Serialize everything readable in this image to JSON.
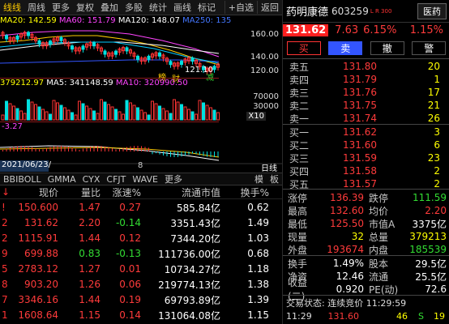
{
  "toolbar": {
    "items": [
      "线线",
      "周线",
      "更多",
      "复权",
      "叠加",
      "多股",
      "统计",
      "画线",
      "标记",
      "+自选",
      "返回"
    ]
  },
  "ma": {
    "ma20": "MA20: 142.59",
    "ma60": "MA60: 151.79",
    "ma120": "MA120: 148.07",
    "ma250": "MA250: 135"
  },
  "price_axis": [
    "160.00",
    "140.00",
    "120.00"
  ],
  "price_low_label": "121.10",
  "event_tags": [
    "榜",
    "财",
    "减"
  ],
  "vol": {
    "vol": "379212.97",
    "ma5": "MA5: 341148.59",
    "ma10": "MA10: 320990.50"
  },
  "vol_axis": [
    "70000",
    "30000"
  ],
  "vol_unit": "X10",
  "macd": "-3.27",
  "date_label": "2021/06/23/三",
  "mid_mark": "8",
  "period": "日线",
  "bottom_tabs": [
    "BBIBOLL",
    "GMMA",
    "CYX",
    "CFJT",
    "WAVE",
    "更多",
    "模",
    "板"
  ],
  "table": {
    "headers": [
      "现价",
      "量比",
      "涨速%",
      "流通市值",
      "换手%"
    ],
    "rows": [
      {
        "mark": "!",
        "price": "150.600",
        "vr": "1.47",
        "spd": "0.27",
        "cap": "585.84亿",
        "tr": "0.62",
        "price_c": "red",
        "vr_c": "red",
        "spd_c": "red"
      },
      {
        "mark": "2",
        "price": "131.62",
        "vr": "2.20",
        "spd": "-0.14",
        "cap": "3351.43亿",
        "tr": "1.49",
        "price_c": "red",
        "vr_c": "red",
        "spd_c": "grn"
      },
      {
        "mark": "2",
        "price": "1115.91",
        "vr": "1.44",
        "spd": "0.12",
        "cap": "7344.20亿",
        "tr": "1.03",
        "price_c": "red",
        "vr_c": "red",
        "spd_c": "red"
      },
      {
        "mark": "9",
        "price": "699.88",
        "vr": "0.83",
        "spd": "-0.13",
        "cap": "111736.00亿",
        "tr": "0.68",
        "price_c": "red",
        "vr_c": "grn",
        "spd_c": "grn"
      },
      {
        "mark": "5",
        "price": "2783.12",
        "vr": "1.27",
        "spd": "0.01",
        "cap": "10734.27亿",
        "tr": "1.18",
        "price_c": "red",
        "vr_c": "red",
        "spd_c": "red"
      },
      {
        "mark": "8",
        "price": "903.20",
        "vr": "1.26",
        "spd": "0.06",
        "cap": "219774.13亿",
        "tr": "1.38",
        "price_c": "red",
        "vr_c": "red",
        "spd_c": "red"
      },
      {
        "mark": "7",
        "price": "3346.16",
        "vr": "1.44",
        "spd": "0.19",
        "cap": "69793.89亿",
        "tr": "1.39",
        "price_c": "red",
        "vr_c": "red",
        "spd_c": "red"
      },
      {
        "mark": "1",
        "price": "1608.64",
        "vr": "1.15",
        "spd": "0.14",
        "cap": "131064.08亿",
        "tr": "1.15",
        "price_c": "red",
        "vr_c": "red",
        "spd_c": "red"
      }
    ]
  },
  "stock": {
    "name": "药明康德",
    "code": "603259",
    "tag": "L R 300",
    "sector": "医药",
    "price": "131.62",
    "chg": "7.63",
    "pct": "6.15%",
    "sector_pct": "1.15%"
  },
  "actions": [
    "买",
    "卖",
    "撤",
    "警"
  ],
  "asks": [
    {
      "l": "卖五",
      "p": "131.80",
      "v": "20"
    },
    {
      "l": "卖四",
      "p": "131.79",
      "v": "1"
    },
    {
      "l": "卖三",
      "p": "131.76",
      "v": "17"
    },
    {
      "l": "卖二",
      "p": "131.75",
      "v": "21"
    },
    {
      "l": "卖一",
      "p": "131.74",
      "v": "26"
    }
  ],
  "bids": [
    {
      "l": "买一",
      "p": "131.62",
      "v": "3"
    },
    {
      "l": "买二",
      "p": "131.60",
      "v": "6"
    },
    {
      "l": "买三",
      "p": "131.59",
      "v": "23"
    },
    {
      "l": "买四",
      "p": "131.58",
      "v": "2"
    },
    {
      "l": "买五",
      "p": "131.57",
      "v": "2"
    }
  ],
  "stats": [
    {
      "a": "涨停",
      "b": "136.39",
      "bc": "red",
      "c": "跌停",
      "d": "111.59",
      "dc": "grn"
    },
    {
      "a": "最高",
      "b": "132.60",
      "bc": "red",
      "c": "均价",
      "d": "2.20",
      "dc": "red"
    },
    {
      "a": "最低",
      "b": "125.50",
      "bc": "red",
      "c": "市值A",
      "d": "3375亿",
      "dc": "wht"
    },
    {
      "a": "现量",
      "b": "32",
      "bc": "yel",
      "c": "总量",
      "d": "379213",
      "dc": "yel"
    },
    {
      "a": "外盘",
      "b": "193674",
      "bc": "red",
      "c": "内盘",
      "d": "185539",
      "dc": "grn"
    }
  ],
  "stats2": [
    {
      "a": "换手",
      "b": "1.49%",
      "c": "股本",
      "d": "29.5亿"
    },
    {
      "a": "净资",
      "b": "12.46",
      "c": "流通",
      "d": "25.5亿"
    },
    {
      "a": "收益(二)",
      "b": "0.920",
      "c": "PE(动)",
      "d": "72.6"
    }
  ],
  "trade_status": "交易状态: 连续竞价 11:29:59",
  "tick": {
    "time": "11:29",
    "price": "131.60",
    "vol": "46",
    "flag": "S",
    "n": "19"
  }
}
